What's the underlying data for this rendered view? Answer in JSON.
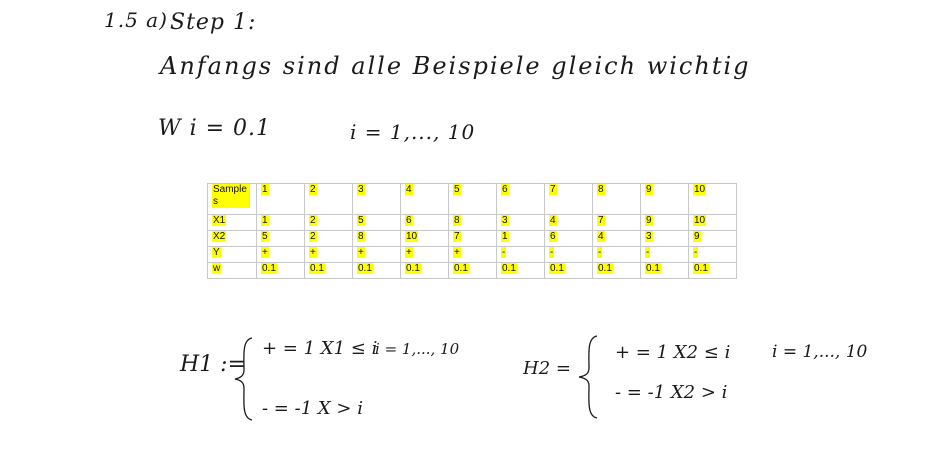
{
  "header": {
    "problem_label": "1.5 a)",
    "step_label": "Step 1:",
    "note": "Anfangs sind alle Beispiele gleich wichtig",
    "weight_init": "W i = 0.1",
    "index_range": "i = 1,..., 10"
  },
  "table": {
    "header_label": "Sample s",
    "columns": [
      "1",
      "2",
      "3",
      "4",
      "5",
      "6",
      "7",
      "8",
      "9",
      "10"
    ],
    "rows": [
      {
        "label": "X1",
        "values": [
          "1",
          "2",
          "5",
          "6",
          "8",
          "3",
          "4",
          "7",
          "9",
          "10"
        ]
      },
      {
        "label": "X2",
        "values": [
          "5",
          "2",
          "8",
          "10",
          "7",
          "1",
          "6",
          "4",
          "3",
          "9"
        ]
      },
      {
        "label": "Y",
        "values": [
          "+",
          "+",
          "+",
          "+",
          "+",
          "-",
          "-",
          "-",
          "-",
          "-"
        ]
      },
      {
        "label": "w",
        "values": [
          "0.1",
          "0.1",
          "0.1",
          "0.1",
          "0.1",
          "0.1",
          "0.1",
          "0.1",
          "0.1",
          "0.1"
        ]
      }
    ],
    "highlight_color": "#ffff00"
  },
  "hypotheses": {
    "h1": {
      "name": "H1 :=",
      "case1": "+ = 1   X1 ≤ i",
      "case1_range": "i = 1,..., 10",
      "case2": "- = -1   X > i"
    },
    "h2": {
      "name": "H2 =",
      "case1": "+ = 1   X2 ≤ i",
      "case1_range": "i = 1,..., 10",
      "case2": "- = -1   X2 > i"
    }
  }
}
